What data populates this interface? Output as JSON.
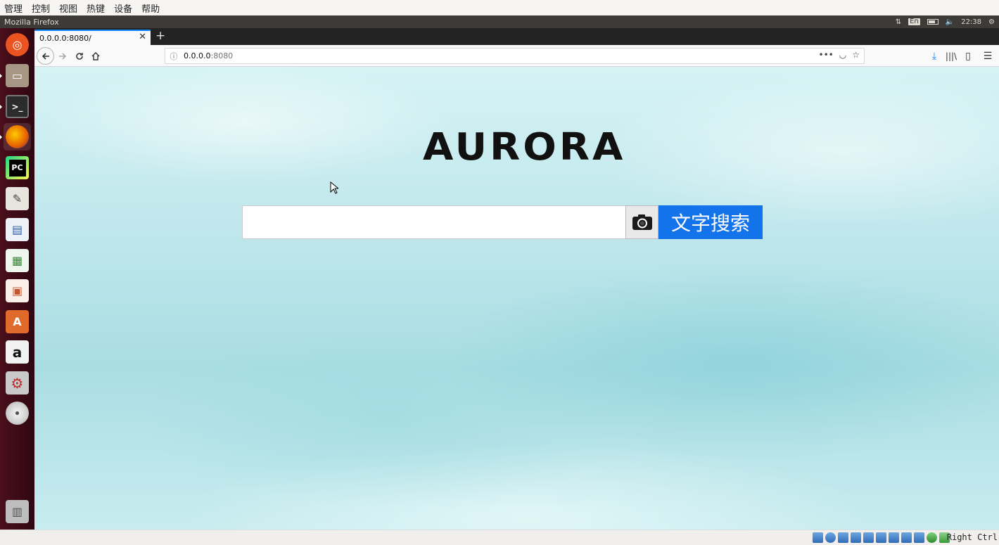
{
  "vbox_menu": [
    "管理",
    "控制",
    "视图",
    "热键",
    "设备",
    "帮助"
  ],
  "panel": {
    "window_title": "Mozilla Firefox",
    "lang": "En",
    "time": "22:38"
  },
  "launcher": {
    "items": [
      {
        "name": "ubuntu-dash",
        "glyph": "◎",
        "color": "#e95420"
      },
      {
        "name": "files",
        "glyph": "▭",
        "color": "#9a8a7a"
      },
      {
        "name": "terminal",
        "glyph": ">_",
        "color": "#2c2c2c"
      },
      {
        "name": "firefox",
        "glyph": "●",
        "color": "#e66000"
      },
      {
        "name": "pycharm",
        "glyph": "PC",
        "color": "#1a1a1a"
      },
      {
        "name": "text-editor",
        "glyph": "✎",
        "color": "#c9c4bc"
      },
      {
        "name": "libreoffice-writer",
        "glyph": "▤",
        "color": "#3c6fb6"
      },
      {
        "name": "libreoffice-calc",
        "glyph": "▦",
        "color": "#3f9a3a"
      },
      {
        "name": "libreoffice-impress",
        "glyph": "▣",
        "color": "#c8542b"
      },
      {
        "name": "software-center",
        "glyph": "A",
        "color": "#e06a2c"
      },
      {
        "name": "amazon",
        "glyph": "a",
        "color": "#e5e5e5"
      },
      {
        "name": "system-settings",
        "glyph": "⚙",
        "color": "#c23a3a"
      },
      {
        "name": "dvd",
        "glyph": "◉",
        "color": "#d9d9d9"
      },
      {
        "name": "trash",
        "glyph": "🗑",
        "color": "#8a8a8a"
      }
    ]
  },
  "browser": {
    "tab_title": "0.0.0.0:8080/",
    "url_host": "0.0.0.0",
    "url_port": ":8080"
  },
  "page": {
    "logo": "AURORA",
    "search_value": "",
    "text_search_label": "文字搜索"
  },
  "vbox_status": {
    "host_key": "Right Ctrl"
  }
}
